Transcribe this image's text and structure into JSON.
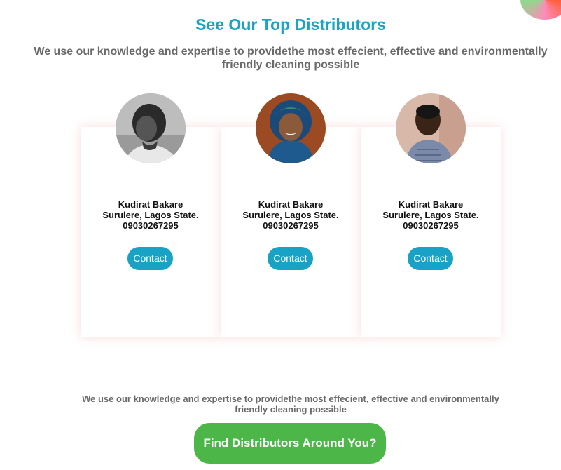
{
  "section": {
    "title": "See Our Top Distributors",
    "subtitle": "We use our knowledge and expertise to providethe most effecient, effective and environmentally friendly cleaning possible"
  },
  "distributors": [
    {
      "name": "Kudirat Bakare",
      "location": "Surulere, Lagos State.",
      "phone": "09030267295",
      "contact_label": "Contact",
      "avatar": "woman-portrait-grayscale"
    },
    {
      "name": "Kudirat Bakare",
      "location": "Surulere, Lagos State.",
      "phone": "09030267295",
      "contact_label": "Contact",
      "avatar": "woman-hijab-portrait"
    },
    {
      "name": "Kudirat Bakare",
      "location": "Surulere, Lagos State.",
      "phone": "09030267295",
      "contact_label": "Contact",
      "avatar": "man-portrait"
    }
  ],
  "footer": {
    "text": "We use our knowledge and expertise to providethe most effecient, effective and environmentally friendly cleaning possible",
    "cta_label": "Find Distributors Around You?"
  },
  "colors": {
    "accent": "#1ca3c4",
    "button": "#17a2c6",
    "cta": "#4cb748"
  }
}
